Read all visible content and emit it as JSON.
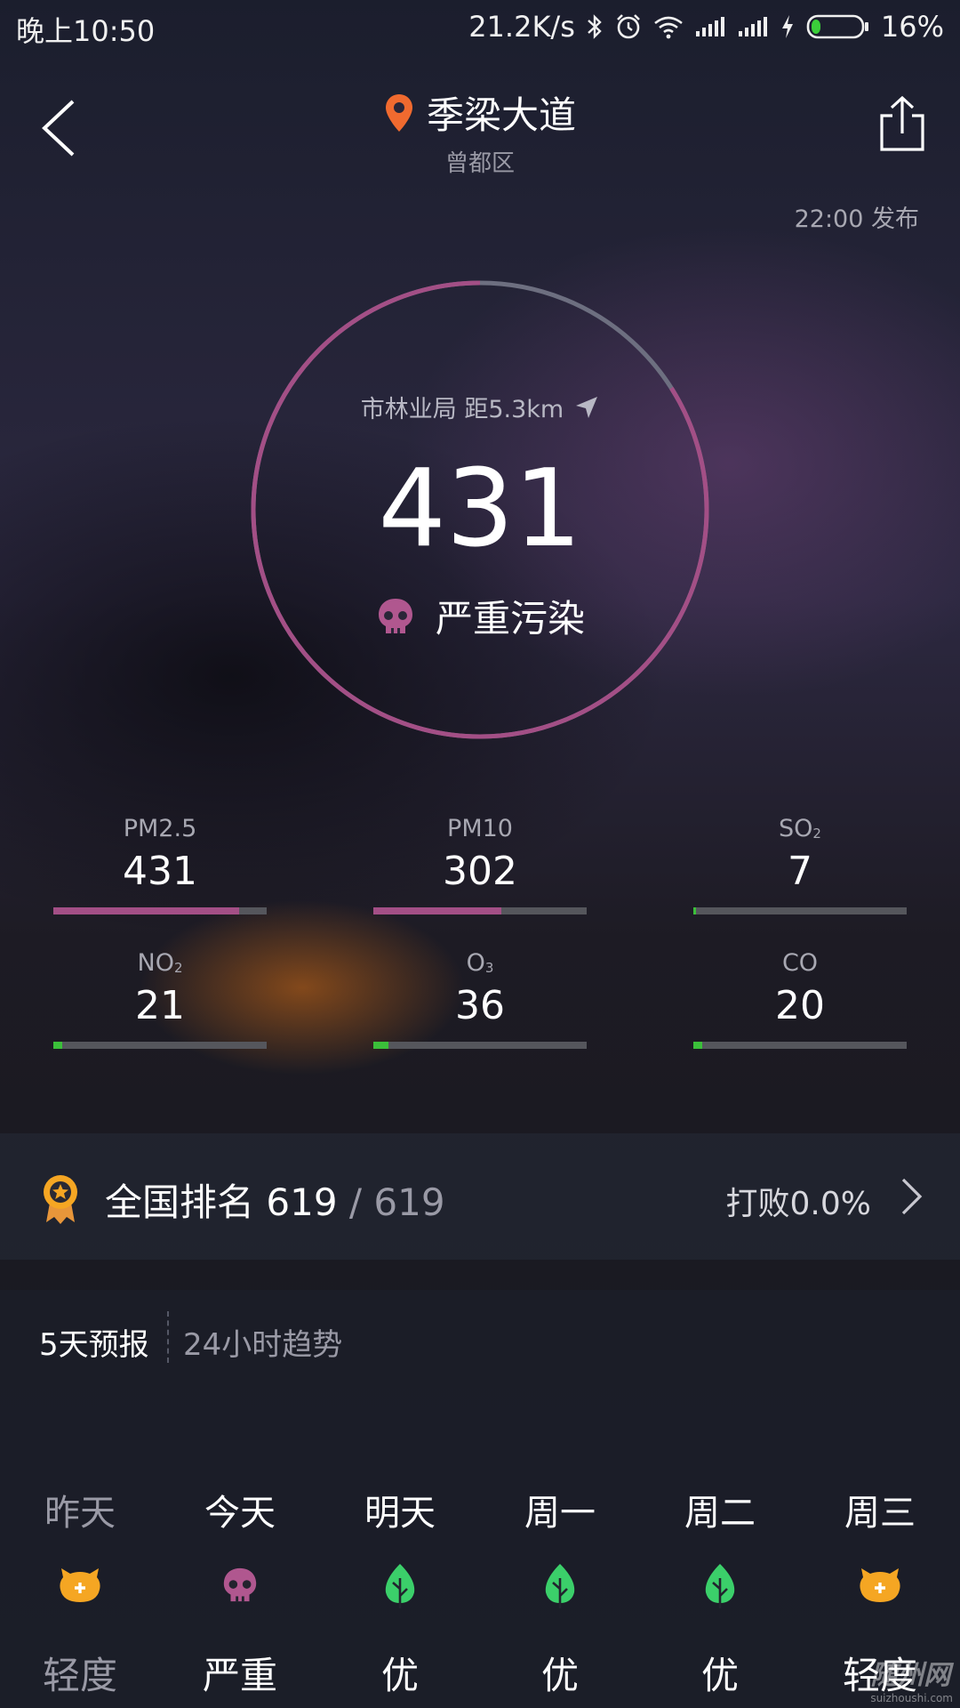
{
  "status_bar": {
    "time": "晚上10:50",
    "speed": "21.2K/s",
    "battery": "16%"
  },
  "header": {
    "title": "季梁大道",
    "subtitle": "曾都区",
    "publish_time": "22:00 发布"
  },
  "aqi": {
    "station": "市林业局 距5.3km",
    "value": "431",
    "level": "严重污染",
    "ring_fraction": 0.84,
    "ring_color": "#a34f86",
    "ring_track_color": "#6d6f80"
  },
  "pollutants": [
    {
      "name": "PM2.5",
      "sub": "",
      "value": "431",
      "level": 0.87,
      "color": "#a34f86"
    },
    {
      "name": "PM10",
      "sub": "",
      "value": "302",
      "level": 0.6,
      "color": "#a34f86"
    },
    {
      "name": "SO",
      "sub": "2",
      "value": "7",
      "level": 0.01,
      "color": "#3bbf3a"
    },
    {
      "name": "NO",
      "sub": "2",
      "value": "21",
      "level": 0.04,
      "color": "#3bbf3a"
    },
    {
      "name": "O",
      "sub": "3",
      "value": "36",
      "level": 0.07,
      "color": "#3bbf3a"
    },
    {
      "name": "CO",
      "sub": "",
      "value": "20",
      "level": 0.04,
      "color": "#3bbf3a"
    }
  ],
  "ranking": {
    "label": "全国排名",
    "rank": "619",
    "separator": " / ",
    "total": "619",
    "beat": "打败0.0%"
  },
  "forecast_tabs": {
    "five_day": "5天预报",
    "hourly": "24小时趋势"
  },
  "forecast": [
    {
      "day": "昨天",
      "icon": "orange-face-icon",
      "level": "轻度",
      "muted": true
    },
    {
      "day": "今天",
      "icon": "skull-icon",
      "level": "严重",
      "muted": false
    },
    {
      "day": "明天",
      "icon": "leaf-icon",
      "level": "优",
      "muted": false
    },
    {
      "day": "周一",
      "icon": "leaf-icon",
      "level": "优",
      "muted": false
    },
    {
      "day": "周二",
      "icon": "leaf-icon",
      "level": "优",
      "muted": false
    },
    {
      "day": "周三",
      "icon": "orange-face-icon",
      "level": "轻度",
      "muted": false
    }
  ],
  "watermark": {
    "text": "随州网",
    "url": "suizhoushi.com"
  },
  "colors": {
    "severe": "#a34f86",
    "good": "#3bbf3a",
    "light": "#f5a623",
    "location_pin": "#f06a2f"
  }
}
